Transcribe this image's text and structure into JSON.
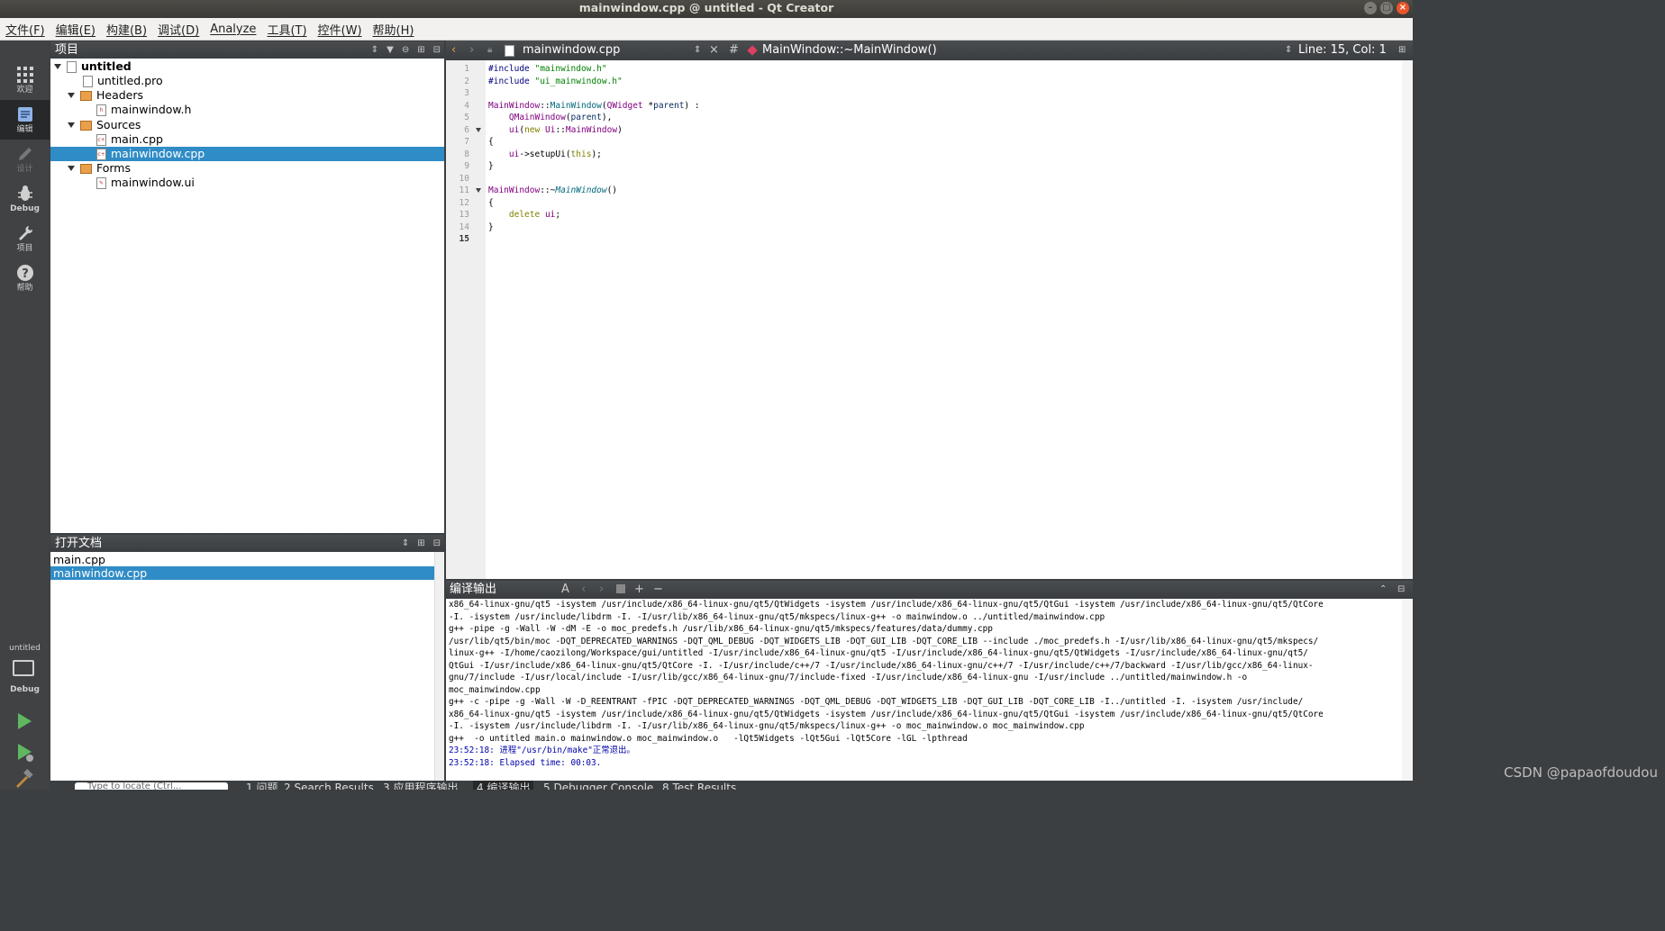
{
  "window": {
    "title": "mainwindow.cpp @ untitled - Qt Creator",
    "controls": [
      "–",
      "□",
      "×"
    ]
  },
  "menu": [
    "文件(F)",
    "编辑(E)",
    "构建(B)",
    "调试(D)",
    "Analyze",
    "工具(T)",
    "控件(W)",
    "帮助(H)"
  ],
  "modes": [
    {
      "label": "欢迎",
      "icon": "grid-icon"
    },
    {
      "label": "编辑",
      "icon": "edit-doc-icon"
    },
    {
      "label": "设计",
      "icon": "pencil-icon"
    },
    {
      "label": "Debug",
      "icon": "bug-icon"
    },
    {
      "label": "项目",
      "icon": "wrench-icon"
    },
    {
      "label": "帮助",
      "icon": "help-icon"
    }
  ],
  "kit": {
    "project": "untitled",
    "build_type": "Debug"
  },
  "projects_panel": {
    "title": "项目",
    "tree": [
      {
        "label": "untitled"
      },
      {
        "label": "untitled.pro"
      },
      {
        "label": "Headers"
      },
      {
        "label": "mainwindow.h"
      },
      {
        "label": "Sources"
      },
      {
        "label": "main.cpp"
      },
      {
        "label": "mainwindow.cpp"
      },
      {
        "label": "Forms"
      },
      {
        "label": "mainwindow.ui"
      }
    ]
  },
  "open_docs": {
    "title": "打开文档",
    "items": [
      "main.cpp",
      "mainwindow.cpp"
    ]
  },
  "editor": {
    "file": "mainwindow.cpp",
    "symbol": "MainWindow::~MainWindow()",
    "hash": "#",
    "position": "Line: 15, Col: 1",
    "line_numbers": [
      "1",
      "2",
      "3",
      "4",
      "5",
      "6",
      "7",
      "8",
      "9",
      "10",
      "11",
      "12",
      "13",
      "14",
      "15"
    ],
    "lines": [
      {
        "parts": [
          {
            "c": "pp",
            "t": "#include "
          },
          {
            "c": "str",
            "t": "\"mainwindow.h\""
          }
        ]
      },
      {
        "parts": [
          {
            "c": "pp",
            "t": "#include "
          },
          {
            "c": "str",
            "t": "\"ui_mainwindow.h\""
          }
        ]
      },
      {
        "parts": []
      },
      {
        "parts": [
          {
            "c": "cls",
            "t": "MainWindow"
          },
          {
            "c": "",
            "t": "::"
          },
          {
            "c": "fn",
            "t": "MainWindow"
          },
          {
            "c": "",
            "t": "("
          },
          {
            "c": "cls",
            "t": "QWidget"
          },
          {
            "c": "",
            "t": " *"
          },
          {
            "c": "par",
            "t": "parent"
          },
          {
            "c": "",
            "t": ") :"
          }
        ]
      },
      {
        "parts": [
          {
            "c": "",
            "t": "    "
          },
          {
            "c": "cls",
            "t": "QMainWindow"
          },
          {
            "c": "",
            "t": "("
          },
          {
            "c": "par",
            "t": "parent"
          },
          {
            "c": "",
            "t": "),"
          }
        ]
      },
      {
        "parts": [
          {
            "c": "",
            "t": "    "
          },
          {
            "c": "cls",
            "t": "ui"
          },
          {
            "c": "",
            "t": "("
          },
          {
            "c": "kw",
            "t": "new"
          },
          {
            "c": "",
            "t": " "
          },
          {
            "c": "cls",
            "t": "Ui"
          },
          {
            "c": "",
            "t": "::"
          },
          {
            "c": "cls",
            "t": "MainWindow"
          },
          {
            "c": "",
            "t": ")"
          }
        ]
      },
      {
        "parts": [
          {
            "c": "",
            "t": "{"
          }
        ]
      },
      {
        "parts": [
          {
            "c": "",
            "t": "    "
          },
          {
            "c": "cls",
            "t": "ui"
          },
          {
            "c": "",
            "t": "->setupUi("
          },
          {
            "c": "kw",
            "t": "this"
          },
          {
            "c": "",
            "t": ");"
          }
        ]
      },
      {
        "parts": [
          {
            "c": "",
            "t": "}"
          }
        ]
      },
      {
        "parts": []
      },
      {
        "parts": [
          {
            "c": "cls",
            "t": "MainWindow"
          },
          {
            "c": "",
            "t": "::~"
          },
          {
            "c": "fn it",
            "t": "MainWindow"
          },
          {
            "c": "",
            "t": "()"
          }
        ]
      },
      {
        "parts": [
          {
            "c": "",
            "t": "{"
          }
        ]
      },
      {
        "parts": [
          {
            "c": "",
            "t": "    "
          },
          {
            "c": "kw",
            "t": "delete"
          },
          {
            "c": "",
            "t": " "
          },
          {
            "c": "cls",
            "t": "ui"
          },
          {
            "c": "",
            "t": ";"
          }
        ]
      },
      {
        "parts": [
          {
            "c": "",
            "t": "}"
          }
        ]
      },
      {
        "parts": []
      }
    ]
  },
  "compile_output": {
    "title": "编译输出",
    "lines": [
      {
        "t": "x86_64-linux-gnu/qt5 -isystem /usr/include/x86_64-linux-gnu/qt5/QtWidgets -isystem /usr/include/x86_64-linux-gnu/qt5/QtGui -isystem /usr/include/x86_64-linux-gnu/qt5/QtCore",
        "msg": false
      },
      {
        "t": "-I. -isystem /usr/include/libdrm -I. -I/usr/lib/x86_64-linux-gnu/qt5/mkspecs/linux-g++ -o mainwindow.o ../untitled/mainwindow.cpp",
        "msg": false
      },
      {
        "t": "g++ -pipe -g -Wall -W -dM -E -o moc_predefs.h /usr/lib/x86_64-linux-gnu/qt5/mkspecs/features/data/dummy.cpp",
        "msg": false
      },
      {
        "t": "/usr/lib/qt5/bin/moc -DQT_DEPRECATED_WARNINGS -DQT_QML_DEBUG -DQT_WIDGETS_LIB -DQT_GUI_LIB -DQT_CORE_LIB --include ./moc_predefs.h -I/usr/lib/x86_64-linux-gnu/qt5/mkspecs/",
        "msg": false
      },
      {
        "t": "linux-g++ -I/home/caozilong/Workspace/gui/untitled -I/usr/include/x86_64-linux-gnu/qt5 -I/usr/include/x86_64-linux-gnu/qt5/QtWidgets -I/usr/include/x86_64-linux-gnu/qt5/",
        "msg": false
      },
      {
        "t": "QtGui -I/usr/include/x86_64-linux-gnu/qt5/QtCore -I. -I/usr/include/c++/7 -I/usr/include/x86_64-linux-gnu/c++/7 -I/usr/include/c++/7/backward -I/usr/lib/gcc/x86_64-linux-",
        "msg": false
      },
      {
        "t": "gnu/7/include -I/usr/local/include -I/usr/lib/gcc/x86_64-linux-gnu/7/include-fixed -I/usr/include/x86_64-linux-gnu -I/usr/include ../untitled/mainwindow.h -o",
        "msg": false
      },
      {
        "t": "moc_mainwindow.cpp",
        "msg": false
      },
      {
        "t": "g++ -c -pipe -g -Wall -W -D_REENTRANT -fPIC -DQT_DEPRECATED_WARNINGS -DQT_QML_DEBUG -DQT_WIDGETS_LIB -DQT_GUI_LIB -DQT_CORE_LIB -I../untitled -I. -isystem /usr/include/",
        "msg": false
      },
      {
        "t": "x86_64-linux-gnu/qt5 -isystem /usr/include/x86_64-linux-gnu/qt5/QtWidgets -isystem /usr/include/x86_64-linux-gnu/qt5/QtGui -isystem /usr/include/x86_64-linux-gnu/qt5/QtCore",
        "msg": false
      },
      {
        "t": "-I. -isystem /usr/include/libdrm -I. -I/usr/lib/x86_64-linux-gnu/qt5/mkspecs/linux-g++ -o moc_mainwindow.o moc_mainwindow.cpp",
        "msg": false
      },
      {
        "t": "g++  -o untitled main.o mainwindow.o moc_mainwindow.o   -lQt5Widgets -lQt5Gui -lQt5Core -lGL -lpthread",
        "msg": false
      },
      {
        "t": "23:52:18: 进程\"/usr/bin/make\"正常退出。",
        "msg": true
      },
      {
        "t": "23:52:18: Elapsed time: 00:03.",
        "msg": true
      }
    ]
  },
  "statusbar": {
    "search_placeholder": "Type to locate (Ctrl...",
    "tabs": [
      "1 问题",
      "2 Search Results",
      "3 应用程序输出",
      "4 编译输出",
      "5 Debugger Console",
      "8 Test Results"
    ]
  },
  "watermark": "CSDN @papaofdoudou"
}
